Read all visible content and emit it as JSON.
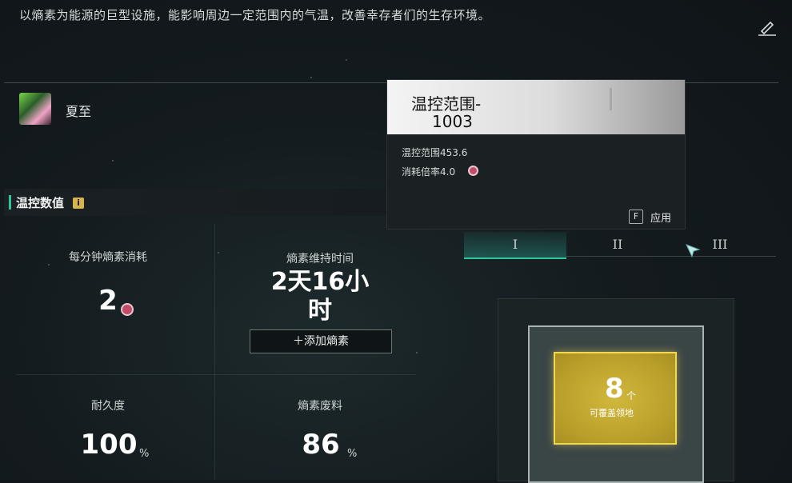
{
  "description": "以熵素为能源的巨型设施，能影响周边一定范围内的气温，改善幸存者们的生存环境。",
  "owner": {
    "name": "夏至"
  },
  "section": {
    "title": "温控数值",
    "info_icon": "i"
  },
  "stats": {
    "consumption": {
      "label": "每分钟熵素消耗",
      "value": "2"
    },
    "duration": {
      "label": "熵素维持时间",
      "value_line1": "2天16小",
      "value_line2": "时",
      "add_button": "＋添加熵素"
    },
    "durability": {
      "label": "耐久度",
      "value": "100",
      "unit": "%"
    },
    "waste": {
      "label": "熵素废料",
      "value": "86",
      "unit": "%"
    }
  },
  "popup": {
    "title_line1": "温控范围-",
    "title_line2": "1003",
    "range_text": "温控范围453.6",
    "rate_text": "消耗倍率4.0",
    "key": "F",
    "apply_label": "应用"
  },
  "tabs": [
    {
      "label": "I",
      "active": true
    },
    {
      "label": "II",
      "active": false
    },
    {
      "label": "III",
      "active": false
    }
  ],
  "coverage": {
    "count": "8",
    "unit": "个",
    "label": "可覆盖领地"
  },
  "colors": {
    "accent": "#2fc49a",
    "gold": "#f0d94f",
    "coin": "#c24b6a"
  }
}
